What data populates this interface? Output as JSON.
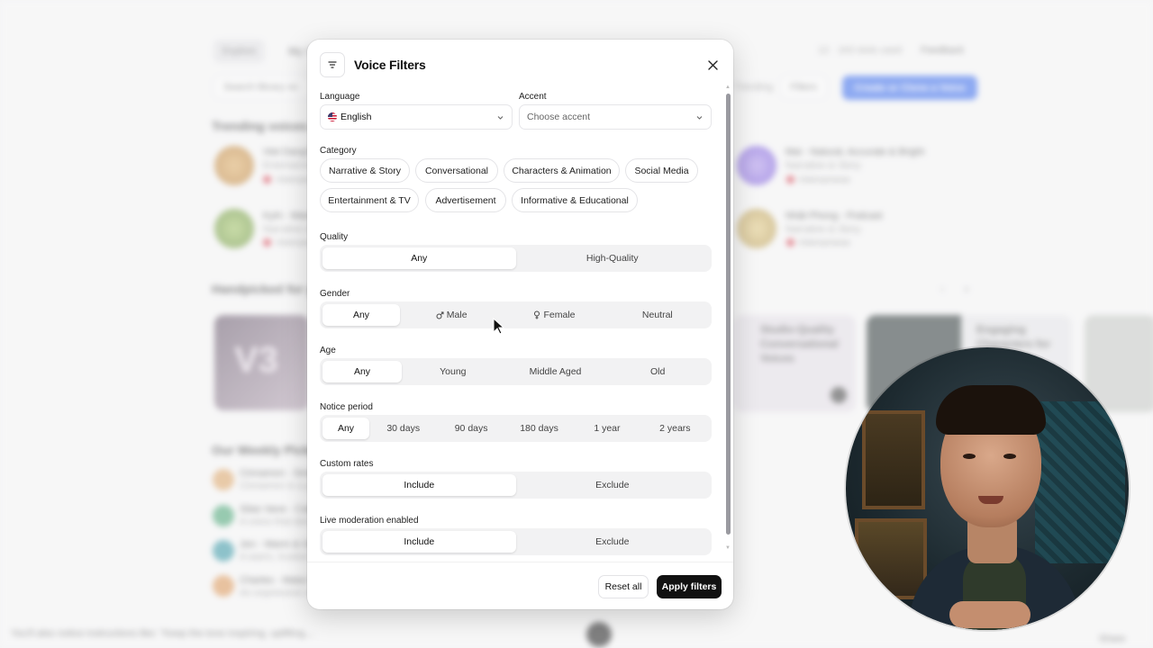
{
  "background": {
    "nav": {
      "explore": "Explore",
      "my_voices": "My V",
      "credits": "12 · 163 slots used",
      "feedback": "Feedback"
    },
    "toolbar": {
      "search_placeholder": "Search library vo",
      "trending": "Trending",
      "filters": "Filters",
      "create_clone": "Create or Clone a Voice"
    },
    "sections": {
      "trending": "Trending voices",
      "handpicked": "Handpicked for y",
      "weekly": "Our Weekly Picks"
    },
    "trending_voices": [
      {
        "name": "Viet DangT",
        "sub": "Entertainme",
        "lang": "Vietnam"
      },
      {
        "name": "KyN - Warr",
        "sub": "Narrative &",
        "lang": "Vietnam"
      },
      {
        "name": "Mai - Natural, Accurate & Bright",
        "sub": "Narrative & Story",
        "lang": "Vietnamese"
      },
      {
        "name": "Nhật Phong - Podcast",
        "sub": "Narrative & Story",
        "lang": "Vietnamese"
      }
    ],
    "handpicked_cards": [
      {
        "label": "V3"
      },
      {
        "label": "Studio-Quality Conversational Voices"
      },
      {
        "label": "Engaging Characters for"
      }
    ],
    "weekly_picks": [
      {
        "name": "Cinnamon - Sma",
        "desc": "Cinnamon is a pl"
      },
      {
        "name": "Silas Vane - Calr",
        "desc": "A voice that deli"
      },
      {
        "name": "Jon - Warm & Gr",
        "desc": "A warm, trusted"
      },
      {
        "name": "Charles - Matur",
        "desc": "An expressive vo"
      }
    ],
    "player": {
      "caption": "You'll also notice instructions like: \"Keep the tone inspiring, uplifting,...",
      "share": "Share"
    }
  },
  "modal": {
    "title": "Voice Filters",
    "icons": {
      "filter": "filter-icon",
      "close": "close-icon",
      "chevron": "chevron-down-icon"
    },
    "language": {
      "label": "Language",
      "value": "English"
    },
    "accent": {
      "label": "Accent",
      "placeholder": "Choose accent"
    },
    "category": {
      "label": "Category",
      "chips": [
        "Narrative & Story",
        "Conversational",
        "Characters & Animation",
        "Social Media",
        "Entertainment & TV",
        "Advertisement",
        "Informative & Educational"
      ]
    },
    "quality": {
      "label": "Quality",
      "options": [
        "Any",
        "High-Quality"
      ],
      "selected": "Any"
    },
    "gender": {
      "label": "Gender",
      "options": [
        "Any",
        "Male",
        "Female",
        "Neutral"
      ],
      "selected": "Any"
    },
    "age": {
      "label": "Age",
      "options": [
        "Any",
        "Young",
        "Middle Aged",
        "Old"
      ],
      "selected": "Any"
    },
    "notice_period": {
      "label": "Notice period",
      "options": [
        "Any",
        "30 days",
        "90 days",
        "180 days",
        "1 year",
        "2 years"
      ],
      "selected": "Any"
    },
    "custom_rates": {
      "label": "Custom rates",
      "options": [
        "Include",
        "Exclude"
      ],
      "selected": "Include"
    },
    "live_moderation": {
      "label": "Live moderation enabled",
      "options": [
        "Include",
        "Exclude"
      ],
      "selected": "Include"
    },
    "footer": {
      "reset": "Reset all",
      "apply": "Apply filters"
    }
  },
  "colors": {
    "accent_blue": "#3b6ef0",
    "primary_button": "#111111",
    "segment_bg": "#f2f2f3"
  }
}
